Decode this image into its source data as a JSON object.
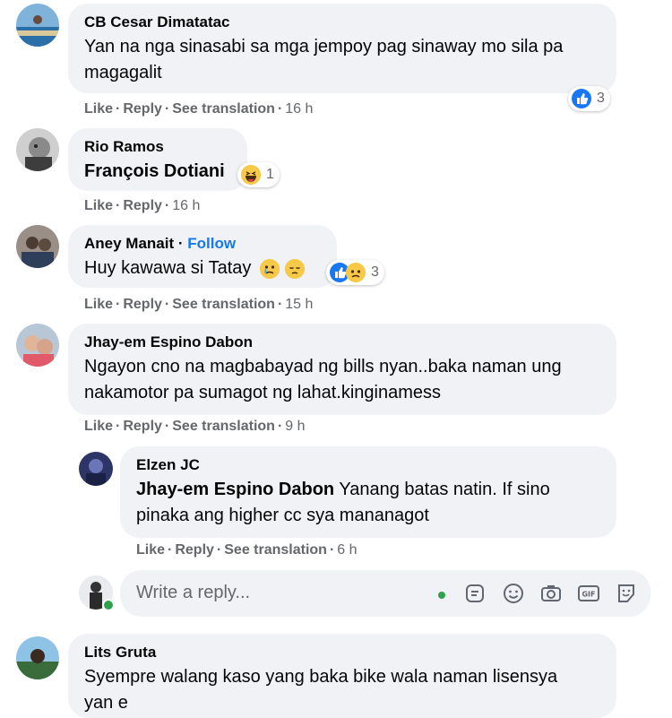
{
  "actions": {
    "like": "Like",
    "reply": "Reply",
    "see_translation": "See translation",
    "sep": "·"
  },
  "comments": [
    {
      "name": "CB Cesar Dimatatac",
      "text": "Yan na nga sinasabi sa mga jempoy pag sinaway mo sila pa magagalit",
      "time": "16 h",
      "reaction_count": "3"
    },
    {
      "name": "Rio Ramos",
      "mention": "François Dotiani",
      "time": "16 h",
      "reaction_count": "1"
    },
    {
      "name": "Aney Manait",
      "follow": "Follow",
      "text": "Huy kawawa si Tatay",
      "time": "15 h",
      "reaction_count": "3"
    },
    {
      "name": "Jhay-em Espino Dabon",
      "text": "Ngayon cno na magbabayad ng bills nyan..baka naman ung nakamotor pa sumagot ng lahat.kinginamess",
      "time": "9 h"
    },
    {
      "name": "Elzen JC",
      "mention": "Jhay-em Espino Dabon",
      "text": "Yanang batas natin. If sino pinaka ang higher cc sya mananagot",
      "time": "6 h"
    },
    {
      "name": "Lits Gruta",
      "text": "Syempre walang kaso yang baka bike wala naman lisensya yan e"
    }
  ],
  "reply_box": {
    "placeholder": "Write a reply...",
    "tools": [
      "sticker-face-icon",
      "emoji-icon",
      "camera-icon",
      "gif-icon",
      "sticker-icon"
    ]
  },
  "colors": {
    "bubble": "#f0f2f5",
    "link": "#1877f2",
    "meta": "#65676b",
    "online": "#31a24c"
  }
}
